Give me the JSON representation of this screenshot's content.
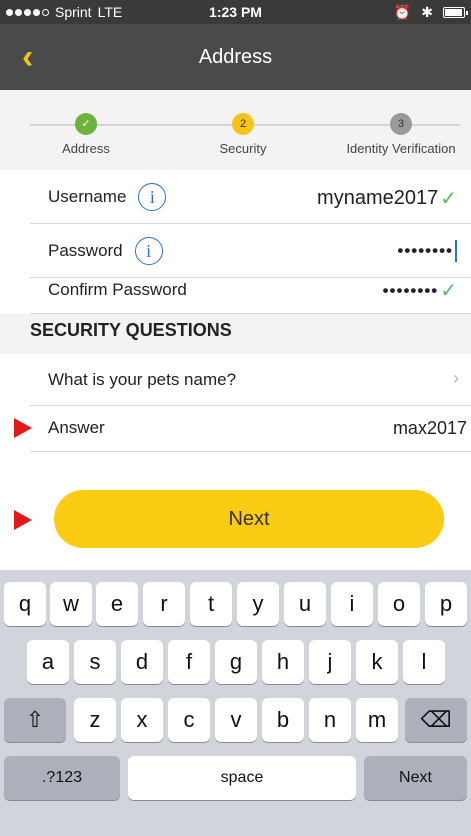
{
  "status_bar": {
    "carrier": "Sprint",
    "network": "LTE",
    "time": "1:23 PM"
  },
  "nav": {
    "back_icon": "chevron-left-icon",
    "title": "Address"
  },
  "stepper": {
    "steps": [
      {
        "number": "",
        "label": "Address",
        "state": "complete"
      },
      {
        "number": "2",
        "label": "Security",
        "state": "current"
      },
      {
        "number": "3",
        "label": "Identity Verification",
        "state": "pending"
      }
    ]
  },
  "form": {
    "username": {
      "label": "Username",
      "value": "myname2017"
    },
    "password": {
      "label": "Password",
      "value": "••••••••"
    },
    "confirm_password": {
      "label": "Confirm Password",
      "value": "••••••••"
    }
  },
  "security": {
    "header": "SECURITY QUESTIONS",
    "question": "What is your pets name?",
    "answer_label": "Answer",
    "answer_value": "max2017"
  },
  "next_label": "Next",
  "keyboard": {
    "row1": [
      "q",
      "w",
      "e",
      "r",
      "t",
      "y",
      "u",
      "i",
      "o",
      "p"
    ],
    "row2": [
      "a",
      "s",
      "d",
      "f",
      "g",
      "h",
      "j",
      "k",
      "l"
    ],
    "row3": [
      "z",
      "x",
      "c",
      "v",
      "b",
      "n",
      "m"
    ],
    "mode_key": ".?123",
    "space_key": "space",
    "return_key": "Next"
  },
  "colors": {
    "accent": "#fccc14",
    "complete": "#6ab43b",
    "info": "#2a73c4",
    "marker": "#e11b1b"
  }
}
